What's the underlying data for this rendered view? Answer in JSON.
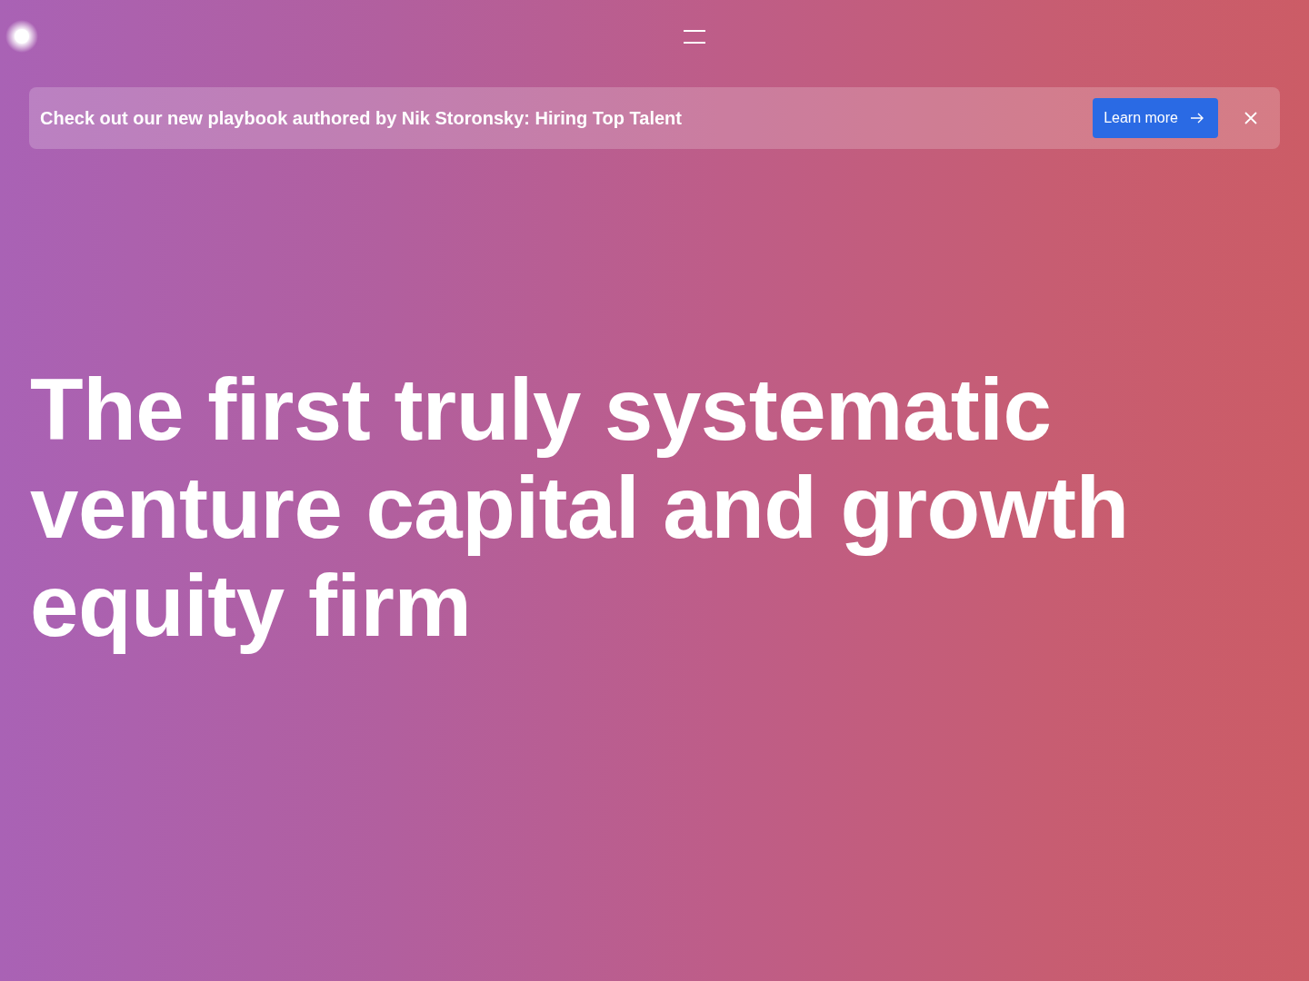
{
  "banner": {
    "text": "Check out our new playbook authored by Nik Storonsky: Hiring Top Talent",
    "button": {
      "label": "Learn more"
    }
  },
  "hero": {
    "headline": "The first truly systematic venture capital and growth equity firm"
  }
}
